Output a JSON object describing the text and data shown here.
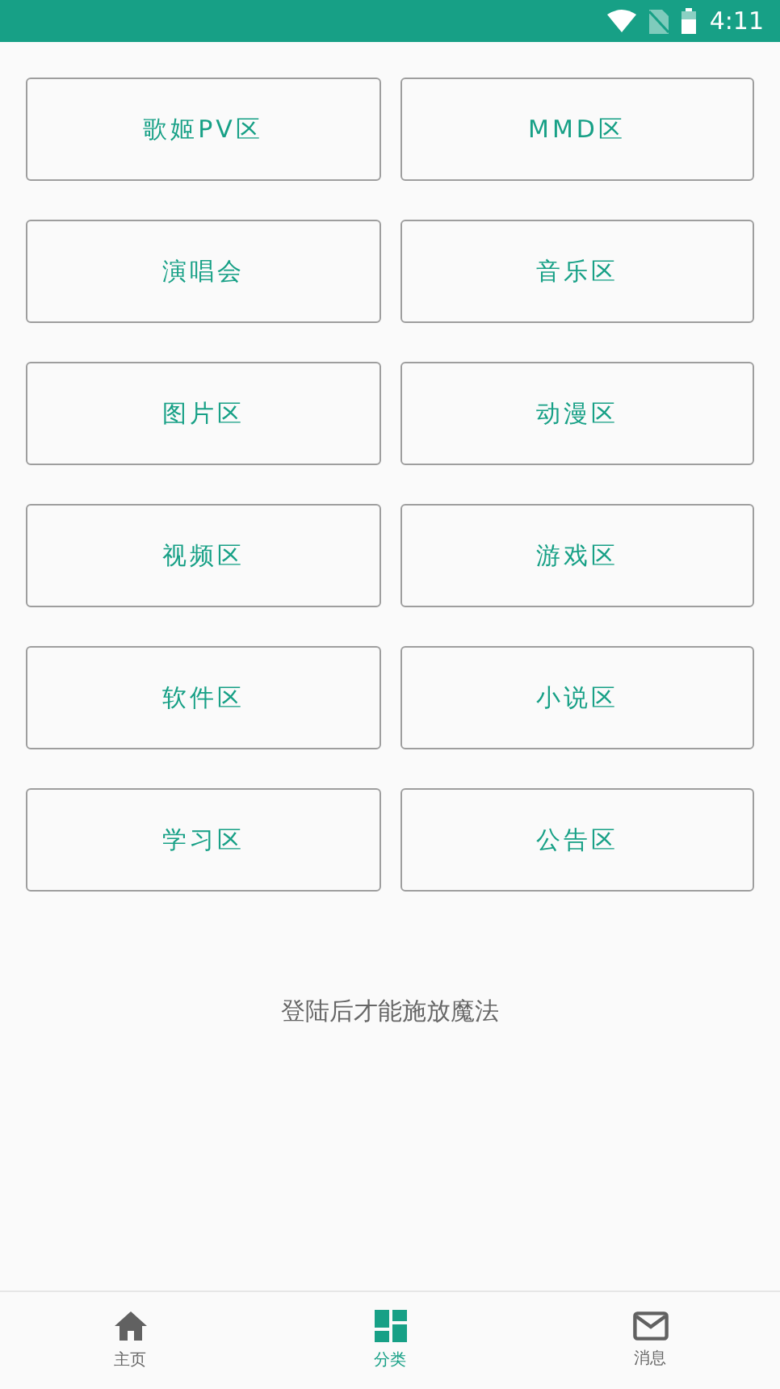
{
  "status_bar": {
    "time": "4:11"
  },
  "categories": [
    {
      "label": "歌姬PV区"
    },
    {
      "label": "MMD区"
    },
    {
      "label": "演唱会"
    },
    {
      "label": "音乐区"
    },
    {
      "label": "图片区"
    },
    {
      "label": "动漫区"
    },
    {
      "label": "视频区"
    },
    {
      "label": "游戏区"
    },
    {
      "label": "软件区"
    },
    {
      "label": "小说区"
    },
    {
      "label": "学习区"
    },
    {
      "label": "公告区"
    }
  ],
  "login_hint": "登陆后才能施放魔法",
  "bottom_nav": [
    {
      "kind": "home",
      "label": "主页",
      "selected": false
    },
    {
      "kind": "category",
      "label": "分类",
      "selected": true
    },
    {
      "kind": "messages",
      "label": "消息",
      "selected": false
    }
  ]
}
